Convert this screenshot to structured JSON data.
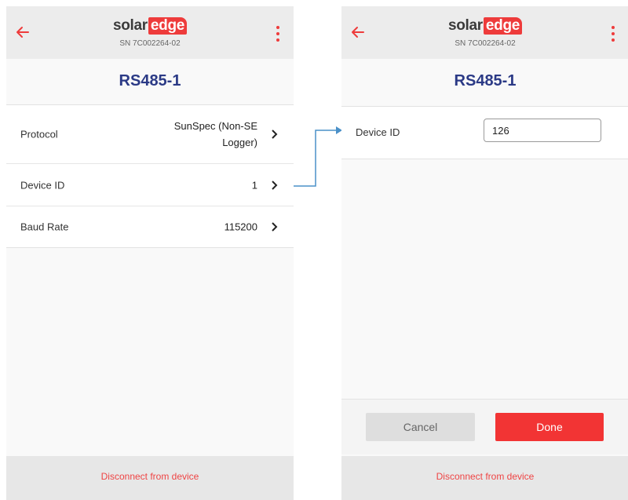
{
  "brand": {
    "name_dark": "solar",
    "name_light": "edge"
  },
  "colors": {
    "accent": "#ee3b3b",
    "title": "#2b3a86",
    "flow_arrow": "#4a90c8"
  },
  "left_screen": {
    "serial": "SN 7C002264-02",
    "title": "RS485-1",
    "rows": [
      {
        "label": "Protocol",
        "value": "SunSpec (Non-SE Logger)"
      },
      {
        "label": "Device ID",
        "value": "1"
      },
      {
        "label": "Baud Rate",
        "value": "115200"
      }
    ],
    "disconnect_label": "Disconnect from device"
  },
  "right_screen": {
    "serial": "SN 7C002264-02",
    "title": "RS485-1",
    "field_label": "Device ID",
    "field_value": "126",
    "cancel_label": "Cancel",
    "done_label": "Done",
    "disconnect_label": "Disconnect from device"
  }
}
